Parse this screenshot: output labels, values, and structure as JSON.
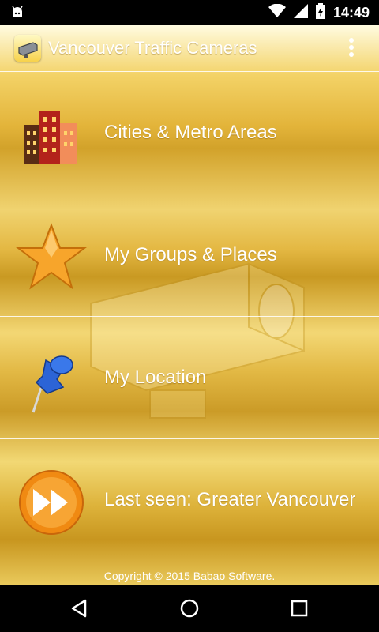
{
  "status_bar": {
    "time": "14:49",
    "icons": [
      "android-debug-icon",
      "wifi-icon",
      "signal-icon",
      "battery-charging-icon"
    ]
  },
  "app_bar": {
    "title": "Vancouver Traffic Cameras",
    "icon": "traffic-camera-icon",
    "overflow": "overflow-menu-icon"
  },
  "menu": {
    "items": [
      {
        "label": "Cities & Metro Areas",
        "icon": "buildings-icon"
      },
      {
        "label": "My Groups & Places",
        "icon": "star-icon"
      },
      {
        "label": "My Location",
        "icon": "pushpin-icon"
      },
      {
        "label": "Last seen: Greater Vancouver",
        "icon": "fast-forward-icon"
      }
    ]
  },
  "footer": {
    "copyright": "Copyright © 2015 Babao Software."
  },
  "nav_bar": {
    "buttons": [
      "back-icon",
      "home-icon",
      "recents-icon"
    ]
  },
  "colors": {
    "accent_gold": "#e3b43a",
    "text": "#ffffff"
  }
}
